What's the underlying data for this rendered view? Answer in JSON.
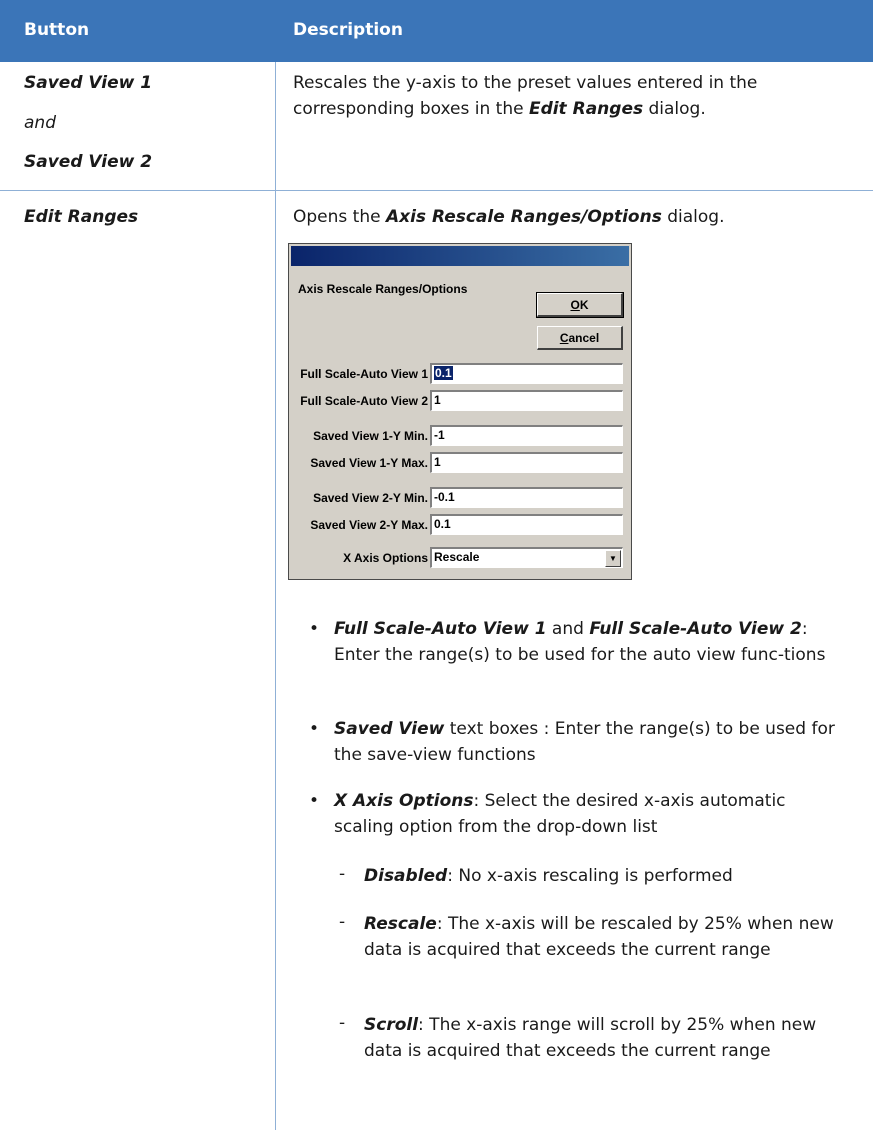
{
  "table": {
    "header": {
      "col1": "Button",
      "col2": "Description"
    },
    "row1": {
      "button_line1": "Saved View 1",
      "button_line2": "and",
      "button_line3": "Saved View 2",
      "desc_pre": "Rescales the y-axis to the preset values entered in the corresponding boxes in the ",
      "desc_bold": "Edit Ranges",
      "desc_post": " dialog."
    },
    "row2": {
      "button": "Edit Ranges",
      "desc_pre": "Opens the ",
      "desc_bold": "Axis Rescale Ranges/Options",
      "desc_post": " dialog."
    }
  },
  "dialog": {
    "title": "Axis Rescale Ranges/Options",
    "ok_prefix": "",
    "ok_underline": "O",
    "ok_rest": "K",
    "cancel_underline": "C",
    "cancel_rest": "ancel",
    "fields": [
      {
        "label": "Full Scale-Auto View 1",
        "value": "0.1",
        "selected": true
      },
      {
        "label": "Full Scale-Auto View 2",
        "value": "1"
      },
      {
        "label": "Saved View 1-Y Min.",
        "value": "-1"
      },
      {
        "label": "Saved View 1-Y Max.",
        "value": "1"
      },
      {
        "label": "Saved View 2-Y Min.",
        "value": "-0.1"
      },
      {
        "label": "Saved View 2-Y Max.",
        "value": "0.1"
      }
    ],
    "xaxis_label": "X Axis Options",
    "xaxis_value": "Rescale",
    "dropdown_arrow": "▼"
  },
  "bullets": {
    "b1": {
      "bold1": "Full Scale-Auto View 1",
      "mid": " and ",
      "bold2": "Full Scale-Auto View 2",
      "text": ": Enter the range(s) to be used for the auto view func-tions"
    },
    "b2": {
      "bold": "Saved View",
      "text": " text boxes : Enter the range(s) to be used for the save-view functions"
    },
    "b3": {
      "bold": "X Axis Options",
      "text": ": Select the desired x-axis automatic scaling option from the drop-down list"
    },
    "s1": {
      "bold": "Disabled",
      "text": ": No x-axis rescaling is performed"
    },
    "s2": {
      "bold": "Rescale",
      "text": ": The x-axis will be rescaled by 25% when new data is acquired that exceeds the current range"
    },
    "s3": {
      "bold": "Scroll",
      "text": ": The x-axis range will scroll by 25% when new data is acquired that exceeds the current range"
    },
    "bullet_char": "•",
    "dash_char": "-"
  }
}
